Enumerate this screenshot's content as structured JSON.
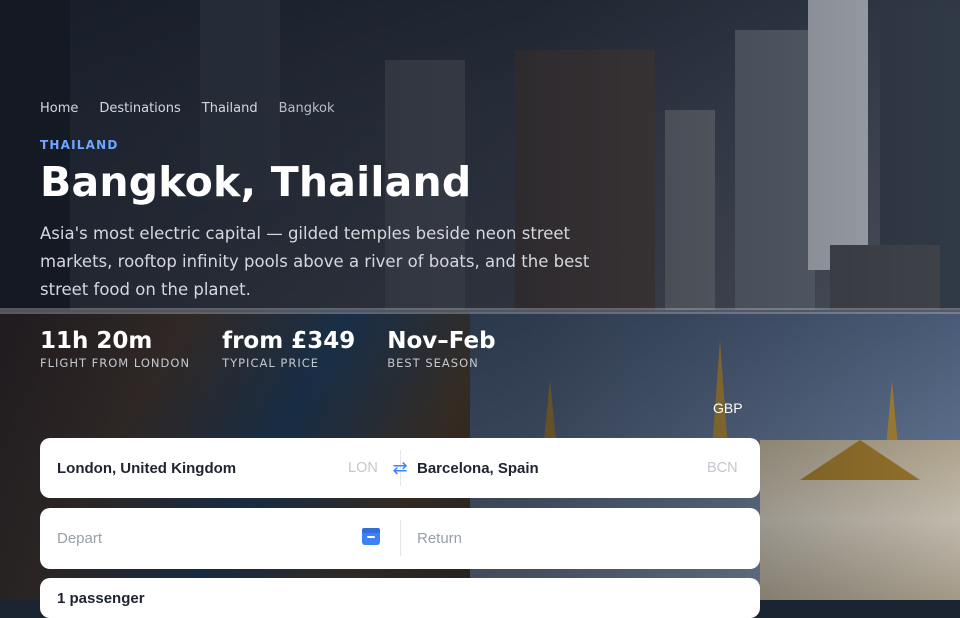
{
  "breadcrumb": [
    "Home",
    "Destinations",
    "Thailand",
    "Bangkok"
  ],
  "eyebrow": "THAILAND",
  "title": "Bangkok, Thailand",
  "description": "Asia's most electric capital — gilded temples beside neon street markets, rooftop infinity pools above a river of boats, and the best street food on the planet.",
  "stats": [
    {
      "value": "11h 20m",
      "label": "FLIGHT FROM LONDON"
    },
    {
      "value": "from £349",
      "label": "TYPICAL PRICE"
    },
    {
      "value": "Nov–Feb",
      "label": "BEST SEASON"
    }
  ],
  "currency": "GBP",
  "search": {
    "origin": {
      "value": "London, United Kingdom",
      "code": "LON"
    },
    "destination": {
      "value": "Barcelona, Spain",
      "code": "BCN"
    },
    "depart_placeholder": "Depart",
    "return_placeholder": "Return",
    "passengers": "1 passenger"
  },
  "icons": {
    "swap": "swap-icon",
    "calendar": "calendar-icon"
  },
  "colors": {
    "accent": "#3b82f6",
    "eyebrow": "#6fa6ff"
  }
}
